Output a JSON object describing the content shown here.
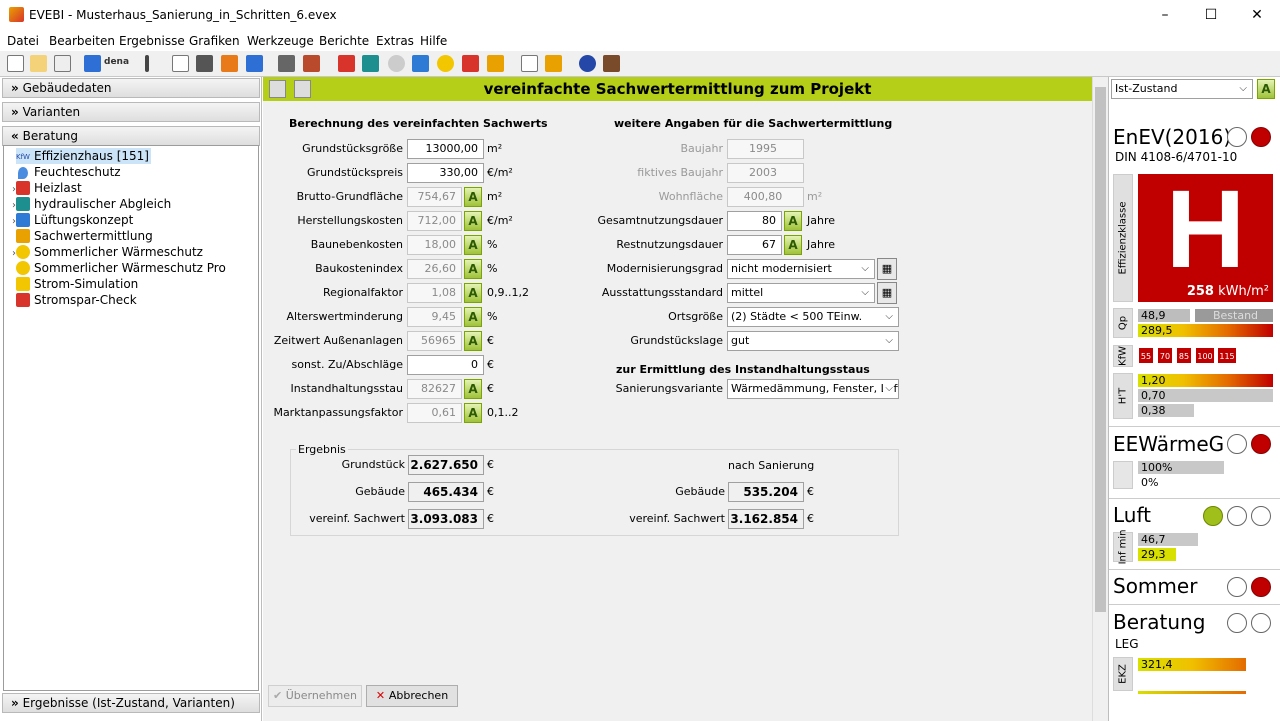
{
  "window": {
    "title": "EVEBI - Musterhaus_Sanierung_in_Schritten_6.evex"
  },
  "menu": [
    "Datei",
    "Bearbeiten",
    "Ergebnisse",
    "Grafiken",
    "Werkzeuge",
    "Berichte",
    "Extras",
    "Hilfe"
  ],
  "toolbar": {
    "dena_label": "dena"
  },
  "left": {
    "sec_gebaeude": "Gebäudedaten",
    "sec_varianten": "Varianten",
    "sec_beratung": "Beratung",
    "tree": [
      {
        "label": "Effizienzhaus [151]",
        "icon": "kfw-icon",
        "color": "#e9eef8"
      },
      {
        "label": "Feuchteschutz",
        "icon": "drop-icon",
        "color": "#4a8de0"
      },
      {
        "label": "Heizlast",
        "icon": "heat-icon",
        "color": "#d9342b"
      },
      {
        "label": "hydraulischer Abgleich",
        "icon": "grid-icon",
        "color": "#1d8f8f"
      },
      {
        "label": "Lüftungskonzept",
        "icon": "fan-icon",
        "color": "#2e7bd6"
      },
      {
        "label": "Sachwertermittlung",
        "icon": "house-icon",
        "color": "#e8a100"
      },
      {
        "label": "Sommerlicher Wärmeschutz",
        "icon": "sun-icon",
        "color": "#f2c600"
      },
      {
        "label": "Sommerlicher Wärmeschutz Pro",
        "icon": "sun-icon",
        "color": "#f2c600"
      },
      {
        "label": "Strom-Simulation",
        "icon": "bolt-icon",
        "color": "#f2c600"
      },
      {
        "label": "Stromspar-Check",
        "icon": "bolt-icon",
        "color": "#d9342b"
      }
    ],
    "kfw_text": "KfW",
    "sec_ergebnisse": "Ergebnisse (Ist-Zustand, Varianten)"
  },
  "main": {
    "title": "vereinfachte Sachwertermittlung zum Projekt",
    "left_header": "Berechnung des vereinfachten Sachwerts",
    "right_header": "weitere Angaben für die Sachwertermittlung",
    "a_label": "A",
    "fields": [
      {
        "label": "Grundstücksgröße",
        "value": "13000,00",
        "unit": "m²"
      },
      {
        "label": "Grundstückspreis",
        "value": "330,00",
        "unit": "€/m²"
      },
      {
        "label": "Brutto-Grundfläche",
        "value": "754,67",
        "unit": "m²"
      },
      {
        "label": "Herstellungskosten",
        "value": "712,00",
        "unit": "€/m²"
      },
      {
        "label": "Baunebenkosten",
        "value": "18,00",
        "unit": "%"
      },
      {
        "label": "Baukostenindex",
        "value": "26,60",
        "unit": "%"
      },
      {
        "label": "Regionalfaktor",
        "value": "1,08",
        "unit": "0,9..1,2"
      },
      {
        "label": "Alterswertminderung",
        "value": "9,45",
        "unit": "%"
      },
      {
        "label": "Zeitwert Außenanlagen",
        "value": "56965",
        "unit": "€"
      },
      {
        "label": "sonst. Zu/Abschläge",
        "value": "0",
        "unit": "€"
      },
      {
        "label": "Instandhaltungsstau",
        "value": "82627",
        "unit": "€"
      },
      {
        "label": "Marktanpassungsfaktor",
        "value": "0,61",
        "unit": "0,1..2"
      }
    ],
    "baujahr_label": "Baujahr",
    "baujahr": "1995",
    "fiktiv_label": "fiktives Baujahr",
    "fiktiv": "2003",
    "wohnflaeche_label": "Wohnfläche",
    "wohnflaeche": "400,80",
    "wohnflaeche_unit": "m²",
    "gnd_label": "Gesamtnutzungsdauer",
    "gnd": "80",
    "gnd_unit": "Jahre",
    "rnd_label": "Restnutzungsdauer",
    "rnd": "67",
    "rnd_unit": "Jahre",
    "mod_label": "Modernisierungsgrad",
    "mod": "nicht modernisiert",
    "aus_label": "Ausstattungsstandard",
    "aus": "mittel",
    "ort_label": "Ortsgröße",
    "ort": "(2) Städte < 500 TEinw.",
    "lage_label": "Grundstückslage",
    "lage": "gut",
    "stau_header": "zur Ermittlung des Instandhaltungsstaus",
    "san_label": "Sanierungsvariante",
    "san": "Wärmedämmung, Fenster, Lüft",
    "ergebnis_title": "Ergebnis",
    "grundstueck_label": "Grundstück",
    "grundstueck": "2.627.650",
    "gebaeude_label": "Gebäude",
    "gebaeude": "465.434",
    "sachwert_label": "vereinf. Sachwert",
    "sachwert": "3.093.083",
    "nach_label": "nach Sanierung",
    "gebaeude2": "535.204",
    "sachwert2": "3.162.854",
    "euro": "€",
    "btn_ok": "Übernehmen",
    "btn_cancel": "Abbrechen"
  },
  "right": {
    "combo": "Ist-Zustand",
    "a_label": "A",
    "enev": "EnEV(2016)",
    "din": "DIN 4108-6/4701-10",
    "eff_label": "Effizienzklasse",
    "eff_class": "H",
    "eff_value": "258",
    "eff_unit": "kWh/m²",
    "qp_label": "Qp",
    "qp1": "48,9",
    "bestand": "Bestand",
    "qp2": "289,5",
    "kfw_label": "KfW",
    "kfw": [
      "55",
      "70",
      "85",
      "100",
      "115"
    ],
    "ht_label": "H'T",
    "ht1": "1,20",
    "ht2": "0,70",
    "ht3": "0,38",
    "eew": "EEWärmeG",
    "eew1": "100%",
    "eew2": "0%",
    "luft": "Luft",
    "inf_label": "Inf min",
    "luft1": "46,7",
    "luft2": "29,3",
    "sommer": "Sommer",
    "beratung": "Beratung",
    "leg": "LEG",
    "ekz_label": "EKZ",
    "ekz": "321,4"
  }
}
